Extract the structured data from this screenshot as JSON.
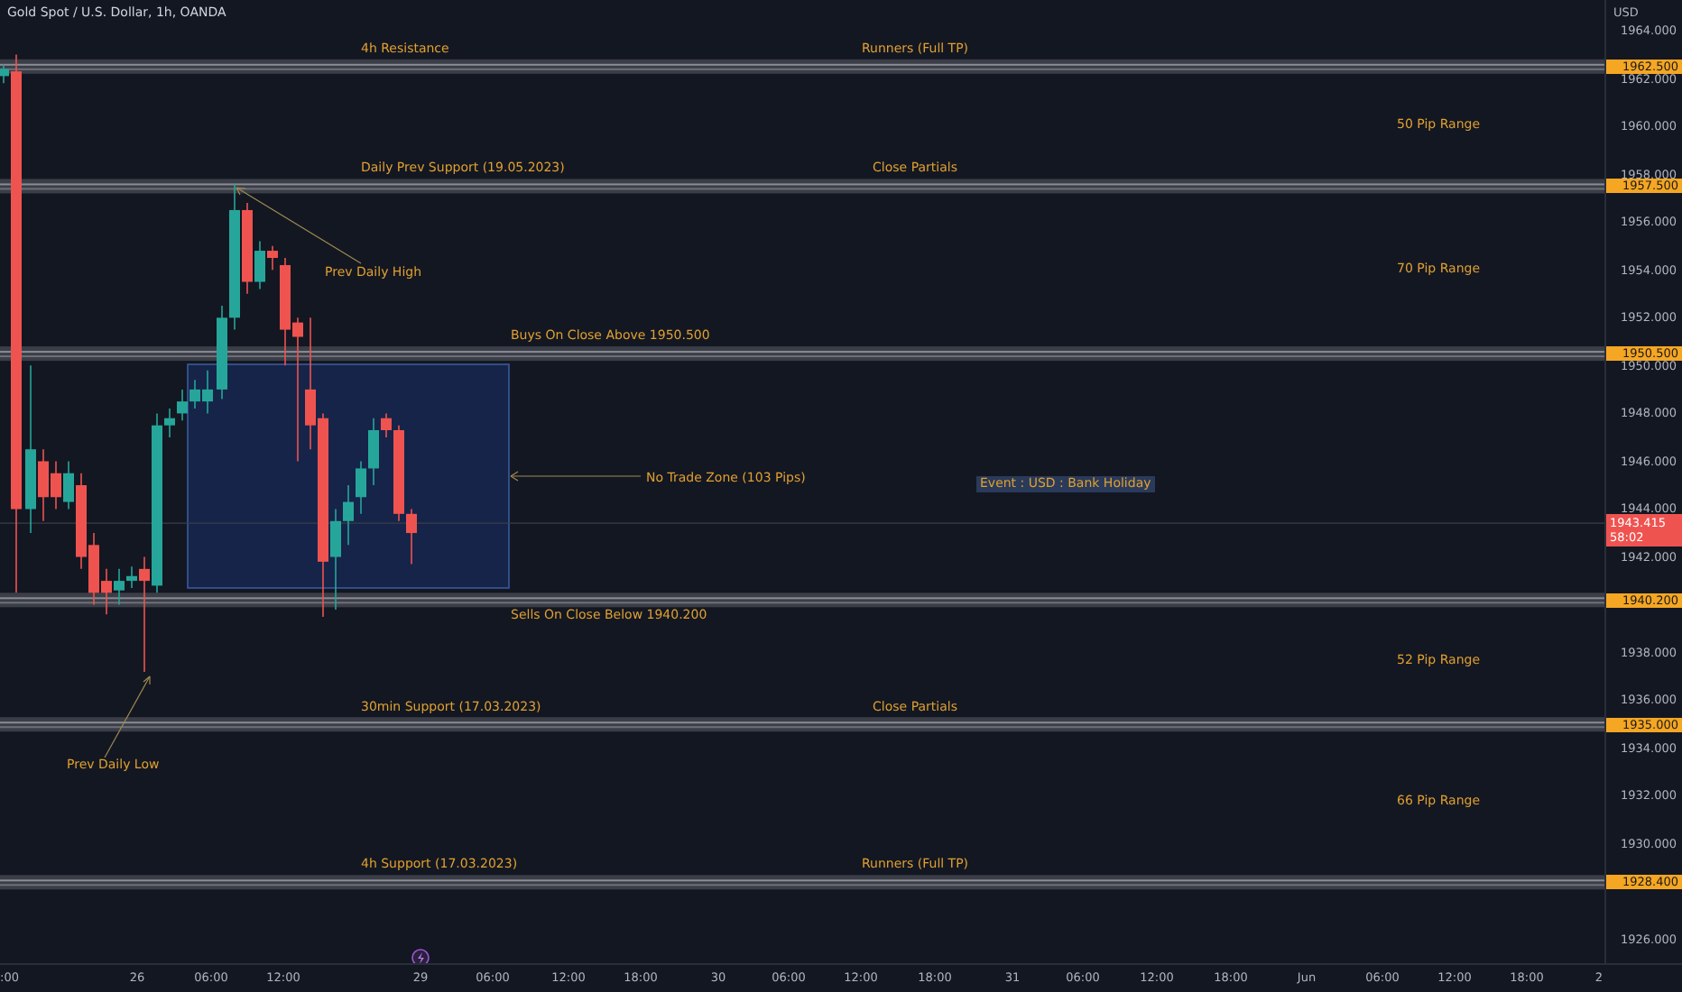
{
  "chart_title": "Gold Spot / U.S. Dollar, 1h, OANDA",
  "axis_unit": "USD",
  "price_ticks": [
    "1964.000",
    "1962.000",
    "1960.000",
    "1958.000",
    "1956.000",
    "1954.000",
    "1952.000",
    "1950.000",
    "1948.000",
    "1946.000",
    "1944.000",
    "1942.000",
    "1938.000",
    "1936.000",
    "1934.000",
    "1932.000",
    "1930.000",
    "1926.000"
  ],
  "levels": [
    {
      "price": "1962.500",
      "labels": [
        {
          "kind": "level",
          "text": "4h Resistance"
        },
        {
          "kind": "target",
          "text": "Runners (Full TP)"
        }
      ],
      "range_below": "50 Pip Range"
    },
    {
      "price": "1957.500",
      "labels": [
        {
          "kind": "level",
          "text": "Daily Prev Support (19.05.2023)"
        },
        {
          "kind": "target",
          "text": "Close Partials"
        }
      ],
      "range_below": "70 Pip Range"
    },
    {
      "price": "1950.500",
      "labels": [
        {
          "kind": "buy",
          "text": "Buys On Close Above 1950.500"
        }
      ]
    },
    {
      "price": "1940.200",
      "labels": [
        {
          "kind": "sell",
          "text": "Sells On Close Below 1940.200"
        }
      ],
      "range_below": "52 Pip Range"
    },
    {
      "price": "1935.000",
      "labels": [
        {
          "kind": "level",
          "text": "30min Support (17.03.2023)"
        },
        {
          "kind": "target",
          "text": "Close Partials"
        }
      ],
      "range_below": "66 Pip Range"
    },
    {
      "price": "1928.400",
      "labels": [
        {
          "kind": "level",
          "text": "4h Support (17.03.2023)"
        },
        {
          "kind": "target",
          "text": "Runners (Full TP)"
        }
      ]
    }
  ],
  "annotations": [
    {
      "kind": "arrow-note",
      "text": "Prev Daily High"
    },
    {
      "kind": "arrow-note",
      "text": "Prev Daily Low"
    },
    {
      "kind": "zone-note",
      "text": "No Trade Zone (103 Pips)"
    },
    {
      "kind": "event",
      "text": "Event : USD : Bank Holiday"
    }
  ],
  "current_price": {
    "price": "1943.415",
    "countdown": "58:02"
  },
  "time_ticks": [
    ":00",
    "26",
    "06:00",
    "12:00",
    "29",
    "06:00",
    "12:00",
    "18:00",
    "30",
    "06:00",
    "12:00",
    "18:00",
    "31",
    "06:00",
    "12:00",
    "18:00",
    "Jun",
    "06:00",
    "12:00",
    "18:00",
    "2"
  ]
}
